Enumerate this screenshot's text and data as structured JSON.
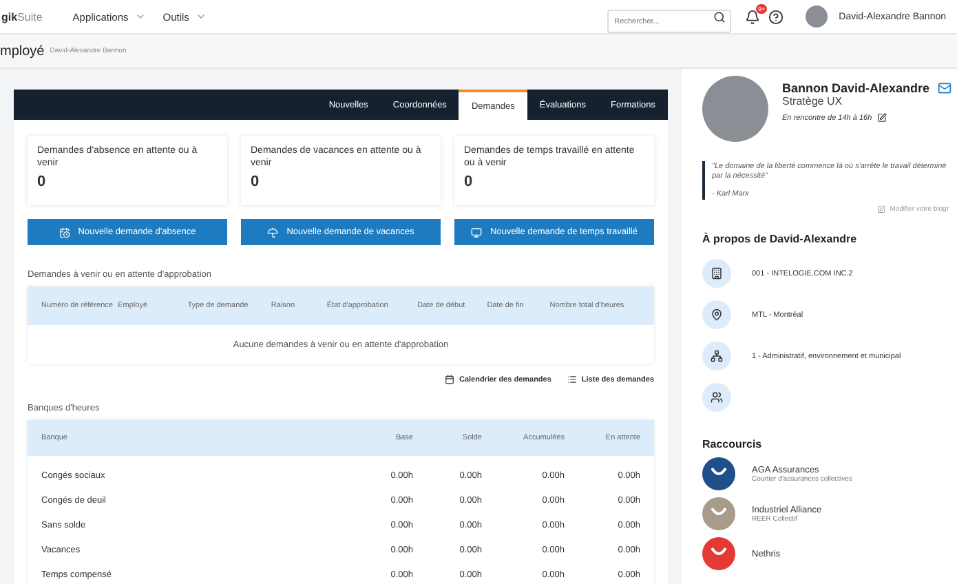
{
  "topbar": {
    "logo": "**gik**Suite",
    "menus": [
      {
        "label": "Applications"
      },
      {
        "label": "Outils"
      }
    ],
    "search": {
      "placeholder": "Rechercher..."
    },
    "notification_badge": "9+",
    "user": "David-Alexandre Bannon"
  },
  "subheader": {
    "title": "mployé",
    "breadcrumb": "David-Alexandre Bannon"
  },
  "tabs": [
    {
      "label": "Nouvelles",
      "selected": false
    },
    {
      "label": "Coordonnées",
      "selected": false
    },
    {
      "label": "Demandes",
      "selected": true
    },
    {
      "label": "Évaluations",
      "selected": false
    },
    {
      "label": "Formations",
      "selected": false
    }
  ],
  "stats": [
    {
      "label": "Demandes d'absence en attente ou à venir",
      "value": "0"
    },
    {
      "label": "Demandes de vacances en attente ou à venir",
      "value": "0"
    },
    {
      "label": "Demandes de temps travaillé en attente ou à venir",
      "value": "0"
    }
  ],
  "actions": [
    {
      "kind": "absence",
      "label": "Nouvelle demande d'absence"
    },
    {
      "kind": "vacation",
      "label": "Nouvelle demande de vacances"
    },
    {
      "kind": "time",
      "label": "Nouvelle demande de temps travaillé"
    }
  ],
  "pending": {
    "title": "Demandes à venir ou en attente d'approbation",
    "columns": [
      "Numéro de référence",
      "Employé",
      "Type de demande",
      "Raison",
      "État d'approbation",
      "Date de début",
      "Date de fin",
      "Nombre total d'heures"
    ],
    "empty": "Aucune demandes à venir ou en attente d'approbation"
  },
  "links": [
    {
      "kind": "calendar",
      "label": "Calendrier des demandes"
    },
    {
      "kind": "list",
      "label": "Liste des demandes"
    }
  ],
  "banks": {
    "title": "Banques d'heures",
    "columns": [
      "Banque",
      "Base",
      "Solde",
      "Accumulées",
      "En attente"
    ],
    "rows": [
      {
        "name": "Congés sociaux",
        "values": [
          "0.00h",
          "0.00h",
          "0.00h",
          "0.00h"
        ]
      },
      {
        "name": "Congés de deuil",
        "values": [
          "0.00h",
          "0.00h",
          "0.00h",
          "0.00h"
        ]
      },
      {
        "name": "Sans solde",
        "values": [
          "0.00h",
          "0.00h",
          "0.00h",
          "0.00h"
        ]
      },
      {
        "name": "Vacances",
        "values": [
          "0.00h",
          "0.00h",
          "0.00h",
          "0.00h"
        ]
      },
      {
        "name": "Temps compensé",
        "values": [
          "0.00h",
          "0.00h",
          "0.00h",
          "0.00h"
        ]
      }
    ]
  },
  "profile": {
    "name": "Bannon David-Alexandre",
    "role": "Stratège UX",
    "status": "En rencontre de 14h à 16h",
    "quote": "\"Le domaine de la liberté commence là où s'arrête le travail déterminé par la nécessité\"",
    "author": "- Karl Marx",
    "edit_link": "Modifier votre biogr"
  },
  "about": {
    "title": "À propos de David-Alexandre",
    "items": [
      {
        "kind": "company",
        "text": "001 - INTELOGIE.COM INC.2"
      },
      {
        "kind": "location",
        "text": "MTL - Montréal"
      },
      {
        "kind": "department",
        "text": "1 - Administratif, environnement et municipal"
      },
      {
        "kind": "team"
      }
    ]
  },
  "shortcuts": {
    "title": "Raccourcis",
    "items": [
      {
        "kind": "aga",
        "name": "AGA Assurances",
        "subtitle": "Courtier d'assurances collectives"
      },
      {
        "kind": "ia",
        "name": "Industriel Alliance",
        "subtitle": "REER Collectif"
      },
      {
        "kind": "nethris",
        "name": "Nethris"
      }
    ]
  }
}
